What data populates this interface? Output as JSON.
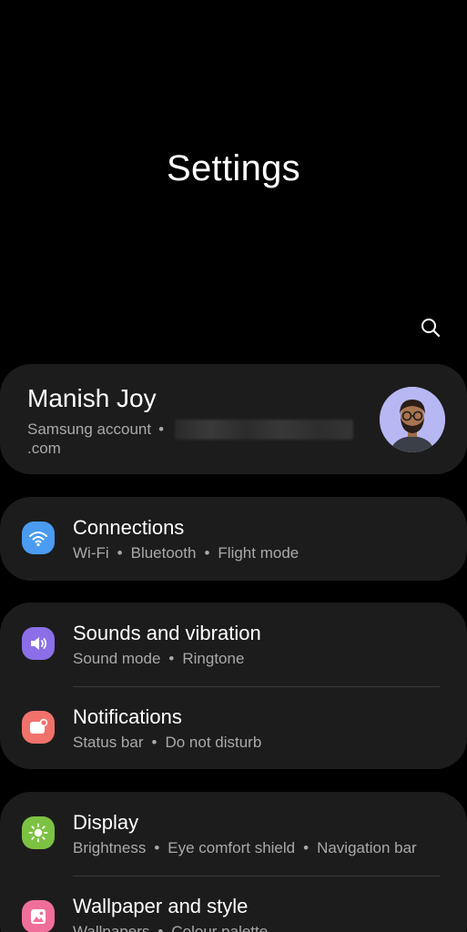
{
  "header": {
    "title": "Settings",
    "search_icon": "search-icon"
  },
  "account": {
    "name": "Manish Joy",
    "label": "Samsung account",
    "separator": "•",
    "domain": ".com",
    "avatar_icon": "avatar"
  },
  "groups": [
    {
      "items": [
        {
          "title": "Connections",
          "subtitle_parts": [
            "Wi-Fi",
            "Bluetooth",
            "Flight mode"
          ],
          "icon": "wifi-icon",
          "icon_color": "#4b9bf0"
        }
      ]
    },
    {
      "items": [
        {
          "title": "Sounds and vibration",
          "subtitle_parts": [
            "Sound mode",
            "Ringtone"
          ],
          "icon": "speaker-icon",
          "icon_color": "#8a6fe8"
        },
        {
          "title": "Notifications",
          "subtitle_parts": [
            "Status bar",
            "Do not disturb"
          ],
          "icon": "notification-icon",
          "icon_color": "#f0726b"
        }
      ]
    },
    {
      "items": [
        {
          "title": "Display",
          "subtitle_parts": [
            "Brightness",
            "Eye comfort shield",
            "Navigation bar"
          ],
          "icon": "sun-icon",
          "icon_color": "#7cc242"
        },
        {
          "title": "Wallpaper and style",
          "subtitle_parts": [
            "Wallpapers",
            "Colour palette"
          ],
          "icon": "wallpaper-icon",
          "icon_color": "#ef6f9a"
        }
      ]
    }
  ],
  "separator": "•",
  "colors": {
    "background": "#000000",
    "card": "#1c1c1c",
    "text_primary": "#ffffff",
    "text_secondary": "#a9a9a9"
  }
}
